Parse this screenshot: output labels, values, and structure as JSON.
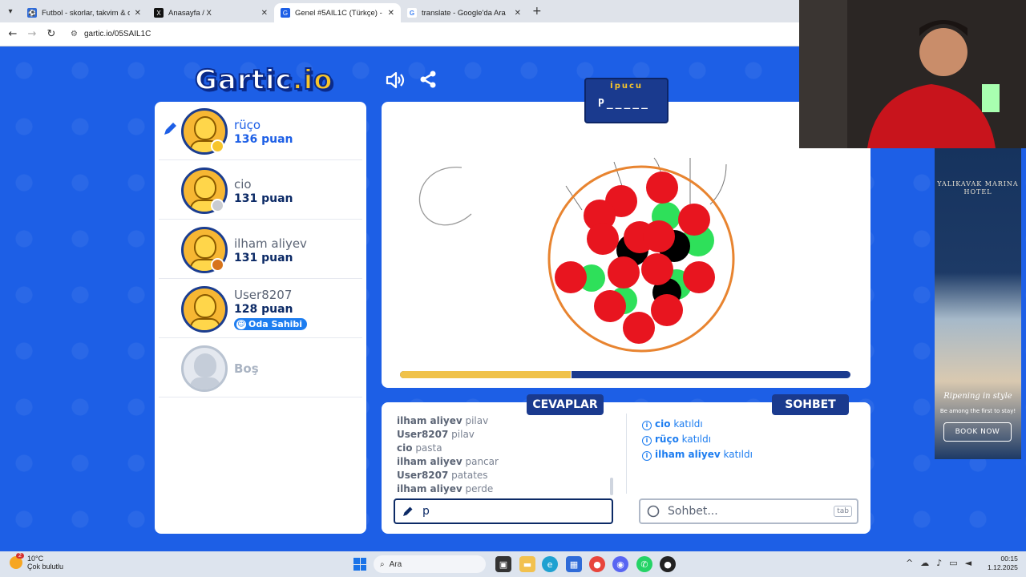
{
  "browser": {
    "tabs": [
      {
        "title": "Futbol - skorlar, takvim & oranlar",
        "icon": "ball-icon",
        "color": "#2f6bd8"
      },
      {
        "title": "Anasayfa / X",
        "icon": "x-logo-icon",
        "color": "#111111"
      },
      {
        "title": "Genel #5AIL1C (Türkçe) - Gartic",
        "icon": "gartic-icon",
        "color": "#1d5fe6"
      },
      {
        "title": "translate - Google'da Ara",
        "icon": "google-icon",
        "color": "#ffffff"
      }
    ],
    "url": "gartic.io/05SAIL1C"
  },
  "game": {
    "logo": "Gartic",
    "logo_io": ".io",
    "hint_label": "İpucu",
    "hint_word": "P_____",
    "progress": 0.38,
    "players": [
      {
        "name": "rüço",
        "score": "136 puan",
        "medal": "#f7c52a",
        "drawer": true
      },
      {
        "name": "cio",
        "score": "131 puan",
        "medal": "#c9ccd2"
      },
      {
        "name": "ilham aliyev",
        "score": "131 puan",
        "medal": "#d7741b"
      },
      {
        "name": "User8207",
        "score": "128 puan",
        "medal": "",
        "owner": "Oda Sahibi"
      },
      {
        "name": "Boş",
        "score": "",
        "empty": true
      }
    ],
    "answers_title": "CEVAPLAR",
    "chat_title": "SOHBET",
    "answers": [
      {
        "name": "ilham aliyev",
        "text": "pilav"
      },
      {
        "name": "User8207",
        "text": "pilav"
      },
      {
        "name": "cio",
        "text": "pasta"
      },
      {
        "name": "ilham aliyev",
        "text": "pancar"
      },
      {
        "name": "User8207",
        "text": "patates"
      },
      {
        "name": "ilham aliyev",
        "text": "perde"
      }
    ],
    "chat": [
      {
        "name": "cio",
        "text": "katıldı"
      },
      {
        "name": "rüço",
        "text": "katıldı"
      },
      {
        "name": "ilham aliyev",
        "text": "katıldı"
      }
    ],
    "answer_input_value": "p",
    "chat_placeholder": "Sohbet...",
    "tab_key": "tab"
  },
  "ad": {
    "hotel": "YALIKAVAK MARINA HOTEL",
    "slogan": "Ripening in style",
    "sub": "Be among the first to stay!",
    "button": "BOOK NOW"
  },
  "taskbar": {
    "temp": "10°C",
    "weather": "Çok bulutlu",
    "notif_count": "2",
    "search": "Ara",
    "time": "00:15",
    "date": "1.12.2025"
  }
}
